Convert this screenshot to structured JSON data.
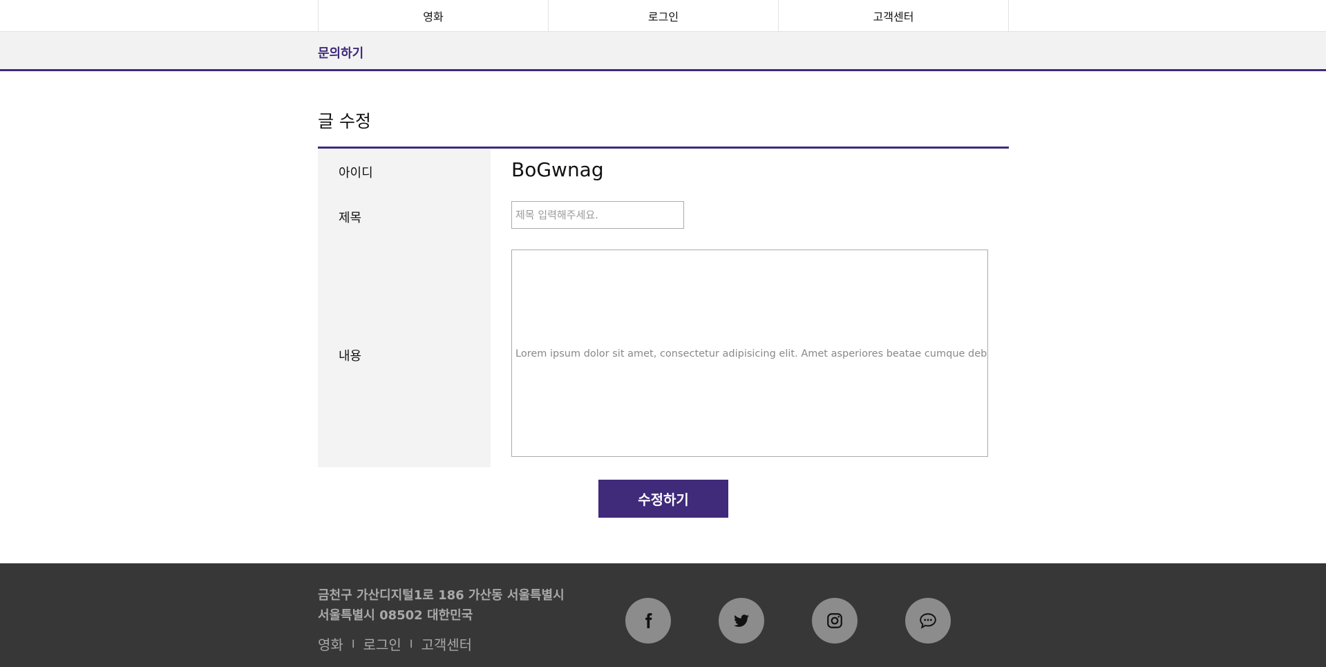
{
  "nav": {
    "items": [
      {
        "label": "영화"
      },
      {
        "label": "로그인"
      },
      {
        "label": "고객센터"
      }
    ]
  },
  "subbar": {
    "title": "문의하기"
  },
  "page": {
    "title": "글 수정"
  },
  "form": {
    "id_label": "아이디",
    "id_value": "BoGwnag",
    "title_label": "제목",
    "title_placeholder": "제목 입력해주세요.",
    "title_value": "",
    "content_label": "내용",
    "content_value": "Lorem ipsum dolor sit amet, consectetur adipisicing elit. Amet asperiores beatae cumque debitis di"
  },
  "submit": {
    "label": "수정하기"
  },
  "footer": {
    "address_line1": "금천구 가산디지털1로 186 가산동 서울특별시",
    "address_line2": "서울특별시 08502 대한민국",
    "links": [
      {
        "label": "영화"
      },
      {
        "label": "로그인"
      },
      {
        "label": "고객센터"
      }
    ],
    "separator": "I",
    "social": [
      "facebook-icon",
      "twitter-icon",
      "instagram-icon",
      "chat-icon"
    ]
  },
  "colors": {
    "accent": "#3f2a7c",
    "button": "#402a7a",
    "footer_bg": "#373737",
    "footer_text": "#a9a9a9",
    "social_bg": "#8c8c8c"
  }
}
